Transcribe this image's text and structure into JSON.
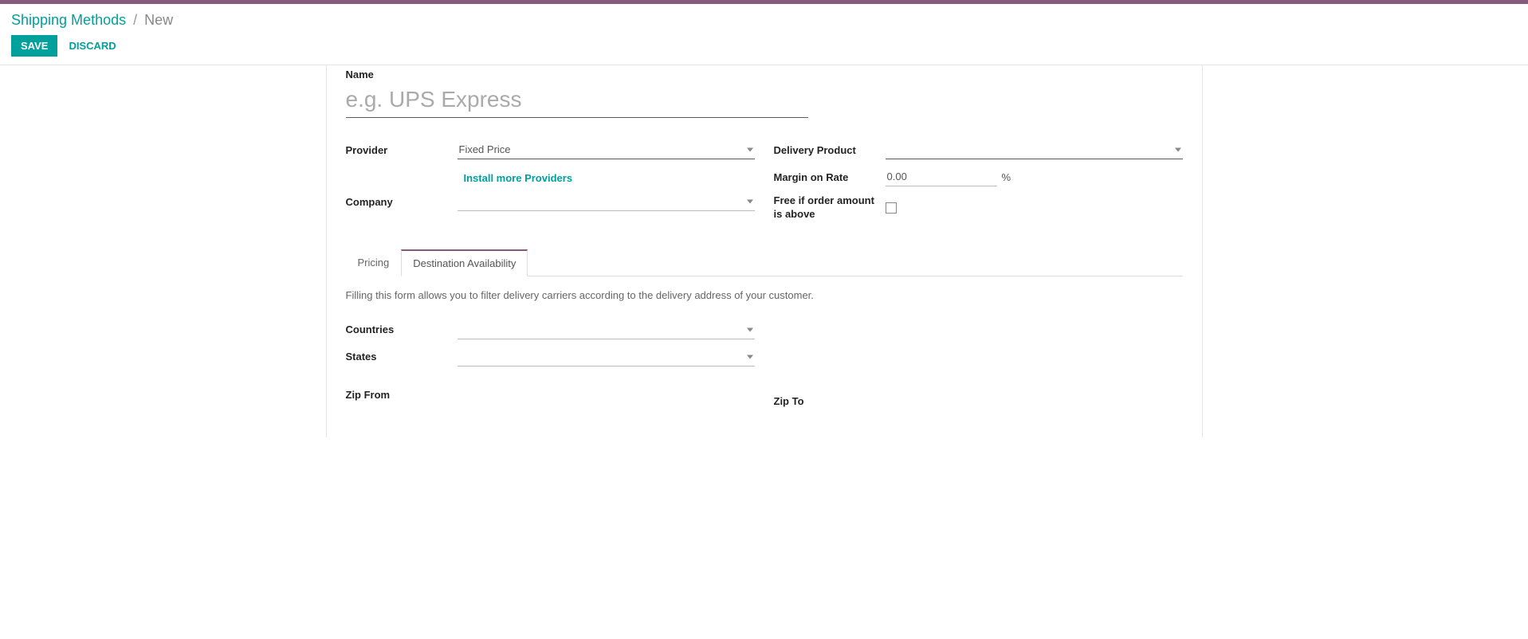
{
  "header": {
    "breadcrumb_parent": "Shipping Methods",
    "breadcrumb_sep": "/",
    "breadcrumb_current": "New",
    "save_label": "SAVE",
    "discard_label": "DISCARD"
  },
  "form": {
    "name_label": "Name",
    "name_placeholder": "e.g. UPS Express",
    "name_value": "",
    "provider_label": "Provider",
    "provider_value": "Fixed Price",
    "install_more_label": "Install more Providers",
    "company_label": "Company",
    "company_value": "",
    "delivery_product_label": "Delivery Product",
    "delivery_product_value": "",
    "margin_label": "Margin on Rate",
    "margin_value": "0.00",
    "margin_suffix": "%",
    "free_if_label": "Free if order amount is above",
    "free_if_checked": false
  },
  "tabs": {
    "pricing_label": "Pricing",
    "dest_label": "Destination Availability"
  },
  "dest": {
    "description": "Filling this form allows you to filter delivery carriers according to the delivery address of your customer.",
    "countries_label": "Countries",
    "countries_value": "",
    "states_label": "States",
    "states_value": "",
    "zip_from_label": "Zip From",
    "zip_from_value": "",
    "zip_to_label": "Zip To",
    "zip_to_value": ""
  }
}
